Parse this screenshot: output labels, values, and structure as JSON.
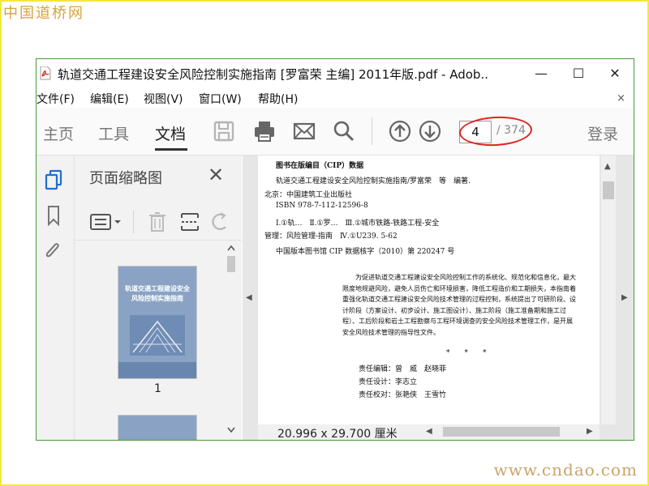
{
  "watermark": {
    "top": "中国道桥网",
    "bottom": "www.cndao.com"
  },
  "window": {
    "title": "轨道交通工程建设安全风险控制实施指南 [罗富荣 主编] 2011年版.pdf - Adob...",
    "minimize_glyph": "—",
    "maximize_glyph": "☐",
    "close_glyph": "✕"
  },
  "menu": {
    "items": [
      "文件(F)",
      "编辑(E)",
      "视图(V)",
      "窗口(W)",
      "帮助(H)"
    ],
    "close_glyph": "×"
  },
  "toolbar": {
    "tabs": [
      "主页",
      "工具",
      "文档"
    ],
    "active_tab": "文档",
    "page_current": "4",
    "page_total": "/ 374",
    "login": "登录",
    "icons": [
      "save-icon",
      "print-icon",
      "email-icon",
      "search-icon",
      "page-up-icon",
      "page-down-icon"
    ]
  },
  "panel": {
    "title": "页面缩略图",
    "close_glyph": "✕",
    "thumbnails": [
      {
        "label": "1",
        "cover_title": "轨道交通工程建设安全风险控制实施指南"
      }
    ]
  },
  "document": {
    "cip_header": "图书在版编目（CIP）数据",
    "lines": [
      "轨道交通工程建设安全风险控制实施指南/罗富荣　等　编著.",
      "北京：中国建筑工业出版社",
      "ISBN 978-7-112-12596-8",
      "Ⅰ.①轨…　Ⅱ.①罗…　Ⅲ.①城市铁路-铁路工程-安全",
      "管理：风险管理-指南　Ⅳ.①U239. 5-62",
      "中国版本图书馆 CIP 数据核字（2010）第 220247 号"
    ],
    "paragraph": "为促进轨道交通工程建设安全风险控制工作的系统化、规范化和信息化，最大限度地规避风险，避免人员伤亡和环境损害，降低工程造价和工期损失，本指南着重强化轨道交通工程建设安全风险技术管理的过程控制，系统提出了可研阶段、设计阶段（方案设计、初步设计、施工图设计）、施工阶段（施工准备期和施工过程）、工后阶段和岩土工程勘察与工程环境调查的安全风险技术管理工作，是开展安全风险技术管理的指导性文件。",
    "stars": "*　　*　　*",
    "credits": [
      "责任编辑：曾　威　赵晓菲",
      "责任设计：李志立",
      "责任校对：张艳侠　王雪竹"
    ],
    "dimensions": "20.996 x 29.700 厘米"
  },
  "colors": {
    "annotation": "#e1231e",
    "frame": "#f5e63c",
    "window_border": "#4a9a3a"
  }
}
